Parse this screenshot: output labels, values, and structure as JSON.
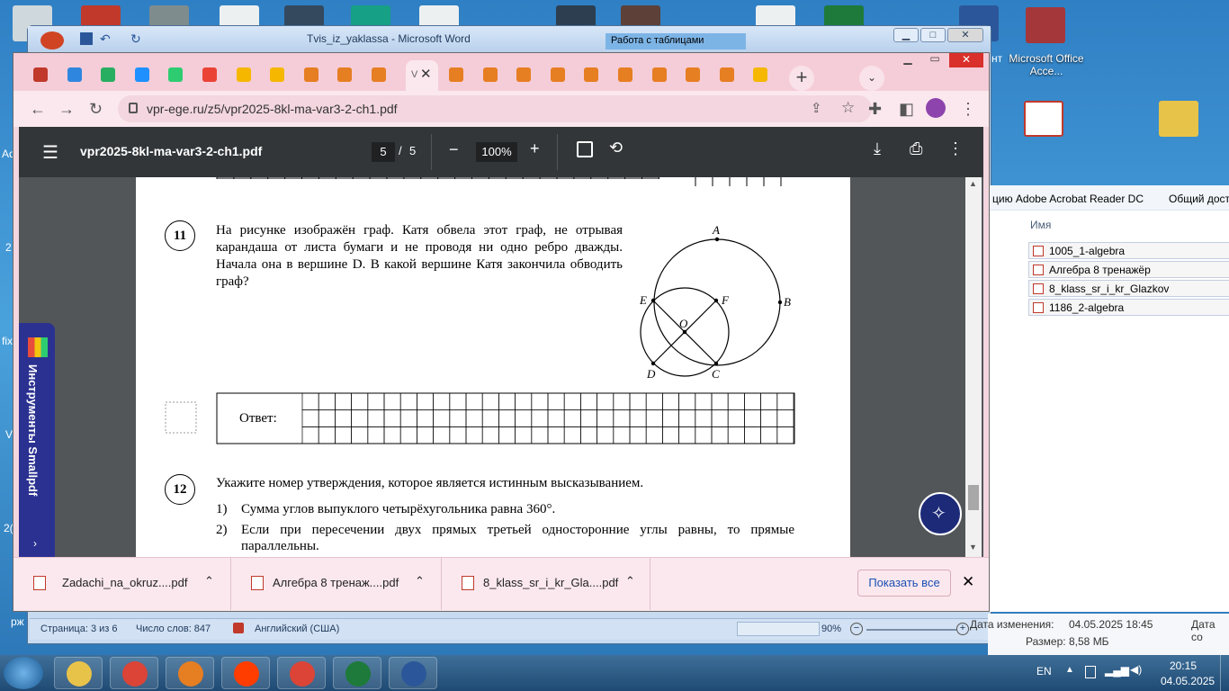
{
  "desktop": {
    "word_title": "Tvis_iz_yaklassa - Microsoft Word",
    "word_context_tab": "Работа с таблицами",
    "desktop_icons": [
      {
        "label": "Microsoft Office Acce...",
        "icon": "access-icon"
      },
      {
        "label": "",
        "icon": "pdf-icon"
      },
      {
        "label": "",
        "icon": "folder-icon"
      }
    ],
    "word_status": {
      "page": "Страница: 3 из 6",
      "words": "Число слов: 847",
      "lang": "Английский (США)",
      "zoom": "90%"
    },
    "left_edge_fragments": [
      "Ad",
      "2",
      "fix",
      "Vi",
      "2(",
      "рж"
    ]
  },
  "explorer": {
    "toolbar": [
      "цию Adobe Acrobat Reader DC",
      "Общий дост"
    ],
    "col_name": "Имя",
    "files": [
      "1005_1-algebra",
      "Алгебра 8 тренажёр",
      "8_klass_sr_i_kr_Glazkov",
      "1186_2-algebra"
    ],
    "details": {
      "modified_label": "Дата изменения:",
      "modified": "04.05.2025 18:45",
      "size_label": "Размер:",
      "size": "8,58 МБ",
      "created_label": "Дата со"
    },
    "partial_right": "нт"
  },
  "chrome": {
    "tabs": [
      {
        "icon": "bug-favicon",
        "color": "#c0392b"
      },
      {
        "icon": "mailbox-favicon",
        "color": "#2e86de"
      },
      {
        "icon": "percent-favicon",
        "color": "#27ae60"
      },
      {
        "icon": "shield-favicon",
        "color": "#1e90ff"
      },
      {
        "icon": "books-favicon",
        "color": "#2ecc71"
      },
      {
        "icon": "google-favicon",
        "color": "#ea4335"
      },
      {
        "icon": "sun-favicon",
        "color": "#f5b700"
      },
      {
        "icon": "sun-favicon",
        "color": "#f5b700"
      },
      {
        "icon": "chart-favicon",
        "color": "#e67e22"
      },
      {
        "icon": "chart-favicon",
        "color": "#e67e22"
      },
      {
        "icon": "chart-favicon",
        "color": "#e67e22"
      }
    ],
    "tabs_after": [
      {
        "icon": "chart-favicon",
        "color": "#e67e22"
      },
      {
        "icon": "chart-favicon",
        "color": "#e67e22"
      },
      {
        "icon": "chart-favicon",
        "color": "#e67e22"
      },
      {
        "icon": "chart-favicon",
        "color": "#e67e22"
      },
      {
        "icon": "chart-favicon",
        "color": "#e67e22"
      },
      {
        "icon": "chart-favicon",
        "color": "#e67e22"
      },
      {
        "icon": "chart-favicon",
        "color": "#e67e22"
      },
      {
        "icon": "chart-favicon",
        "color": "#e67e22"
      },
      {
        "icon": "chart-favicon",
        "color": "#e67e22"
      },
      {
        "icon": "sun-favicon",
        "color": "#f5b700"
      }
    ],
    "active_tab_label": "V",
    "url": "vpr-ege.ru/z5/vpr2025-8kl-ma-var3-2-ch1.pdf"
  },
  "pdf": {
    "filename": "vpr2025-8kl-ma-var3-2-ch1.pdf",
    "page_current": "5",
    "page_sep": "/",
    "page_total": "5",
    "zoom": "100%",
    "sidebar_label": "Инструменты Smallpdf"
  },
  "doc": {
    "q11_num": "11",
    "q11_text": "На рисунке изображён граф. Катя обвела этот граф, не отрывая карандаша от листа бумаги и не проводя ни одно ребро дважды. Начала она в вершине D. В какой вершине Катя закончила обводить граф?",
    "graph_labels": {
      "A": "A",
      "B": "B",
      "C": "C",
      "D": "D",
      "E": "E",
      "F": "F",
      "O": "O"
    },
    "answer_label": "Ответ:",
    "q12_num": "12",
    "q12_text": "Укажите номер утверждения, которое является истинным высказыванием.",
    "q12_items": [
      {
        "n": "1)",
        "text": "Сумма углов выпуклого четырёхугольника равна 360°."
      },
      {
        "n": "2)",
        "text": "Если при пересечении двух прямых третьей односторонние углы равны, то прямые"
      },
      {
        "n": "",
        "text": "параллельны."
      }
    ]
  },
  "downloads": {
    "items": [
      "Zadachi_na_okruz....pdf",
      "Алгебра 8 тренаж....pdf",
      "8_klass_sr_i_kr_Gla....pdf"
    ],
    "show_all": "Показать все"
  },
  "taskbar": {
    "lang": "EN",
    "time": "20:15",
    "date": "04.05.2025",
    "apps": [
      {
        "icon": "file-manager-icon",
        "color": "#e8c34a"
      },
      {
        "icon": "chrome-icon",
        "color": "#db4437"
      },
      {
        "icon": "media-player-icon",
        "color": "#e67e22"
      },
      {
        "icon": "yandex-browser-icon",
        "color": "#ff3d00"
      },
      {
        "icon": "chrome-icon",
        "color": "#db4437"
      },
      {
        "icon": "excel-icon",
        "color": "#1d7a3a"
      },
      {
        "icon": "word-icon",
        "color": "#2b579a"
      }
    ]
  }
}
